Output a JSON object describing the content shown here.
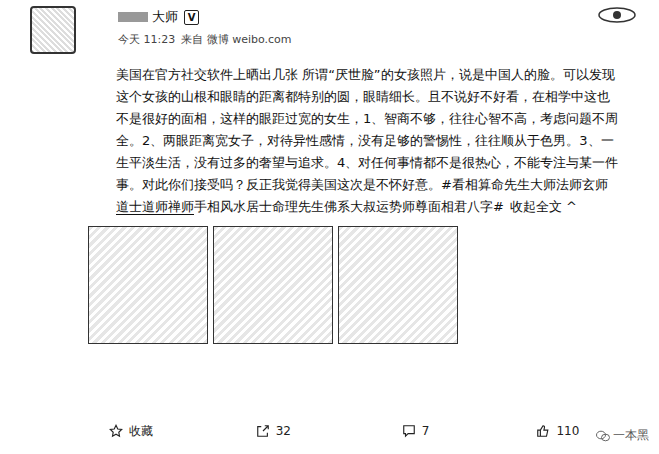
{
  "post": {
    "author": "大师",
    "verified": "V",
    "time": "今天 11:23",
    "source": "来自 微博 weibo.com",
    "body": "美国在官方社交软件上晒出几张 所谓“厌世脸”的女孩照片，说是中国人的脸。可以发现这个女孩的山根和眼睛的距离都特别的圆，眼睛细长。且不说好不好看，在相学中这也不是很好的面相，这样的眼距过宽的女生，1、智商不够，往往心智不高，考虑问题不周全。2、两眼距离宽女子，对待异性感情，没有足够的警惕性，往往顺从于色男。3、一生平淡生活，没有过多的奢望与追求。4、对任何事情都不是很热心，不能专注与某一件事。对此你们接受吗？反正我觉得美国这次是不怀好意。",
    "hashtag": [
      {
        "text": "#看相算命先生大师法师玄师",
        "underlined": false
      },
      {
        "text": "道士道师禅师",
        "underlined": true
      },
      {
        "text": "手相风水居士命理先生佛系大叔运势师尊面相君八字#",
        "underlined": false
      }
    ],
    "collapse": "收起全文",
    "collapse_icon": "^"
  },
  "images": [
    {
      "kind": "photo"
    },
    {
      "kind": "photo"
    },
    {
      "kind": "photo"
    }
  ],
  "actions": [
    {
      "kind": "favorite",
      "label": "收藏"
    },
    {
      "kind": "share",
      "label": "32"
    },
    {
      "kind": "comment",
      "label": "7"
    },
    {
      "kind": "like",
      "label": "110"
    }
  ],
  "watermark": "一本黑"
}
